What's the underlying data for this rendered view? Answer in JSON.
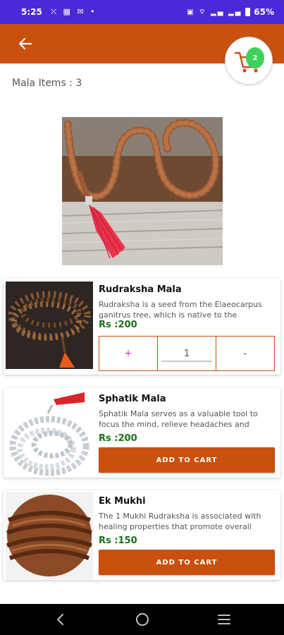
{
  "status_bar": {
    "time": "5:25",
    "left_icons": "⛌ ▦ ✉ •",
    "signal_icons": "▣ ⌔ ▂▄ ▂▄",
    "battery_percent": "65%"
  },
  "header": {
    "back_icon": "arrow-left-icon",
    "cart_icon": "shopping-cart-icon",
    "cart_count": "2",
    "accent_color": "#c9500e"
  },
  "page": {
    "title": "Mala Items : 3"
  },
  "products": [
    {
      "name": "Rudraksha Mala",
      "description": "Rudraksha is a seed from the Elaeocarpus ganitrus tree, which is native to the",
      "price": "Rs :200",
      "in_cart": true,
      "quantity": "1",
      "plus_label": "+",
      "minus_label": "-"
    },
    {
      "name": "Sphatik Mala",
      "description": "Sphatik Mala serves as a valuable tool to focus the mind, relieve headaches and",
      "price": "Rs :200",
      "in_cart": false,
      "button_label": "ADD TO CART"
    },
    {
      "name": "Ek Mukhi",
      "description": "The 1 Mukhi Rudraksha is associated with healing properties that promote overall",
      "price": "Rs :150",
      "in_cart": false,
      "button_label": "ADD TO CART"
    }
  ],
  "nav_bar": {
    "back_icon": "nav-back-icon",
    "home_icon": "nav-home-icon",
    "menu_icon": "nav-recents-icon"
  }
}
